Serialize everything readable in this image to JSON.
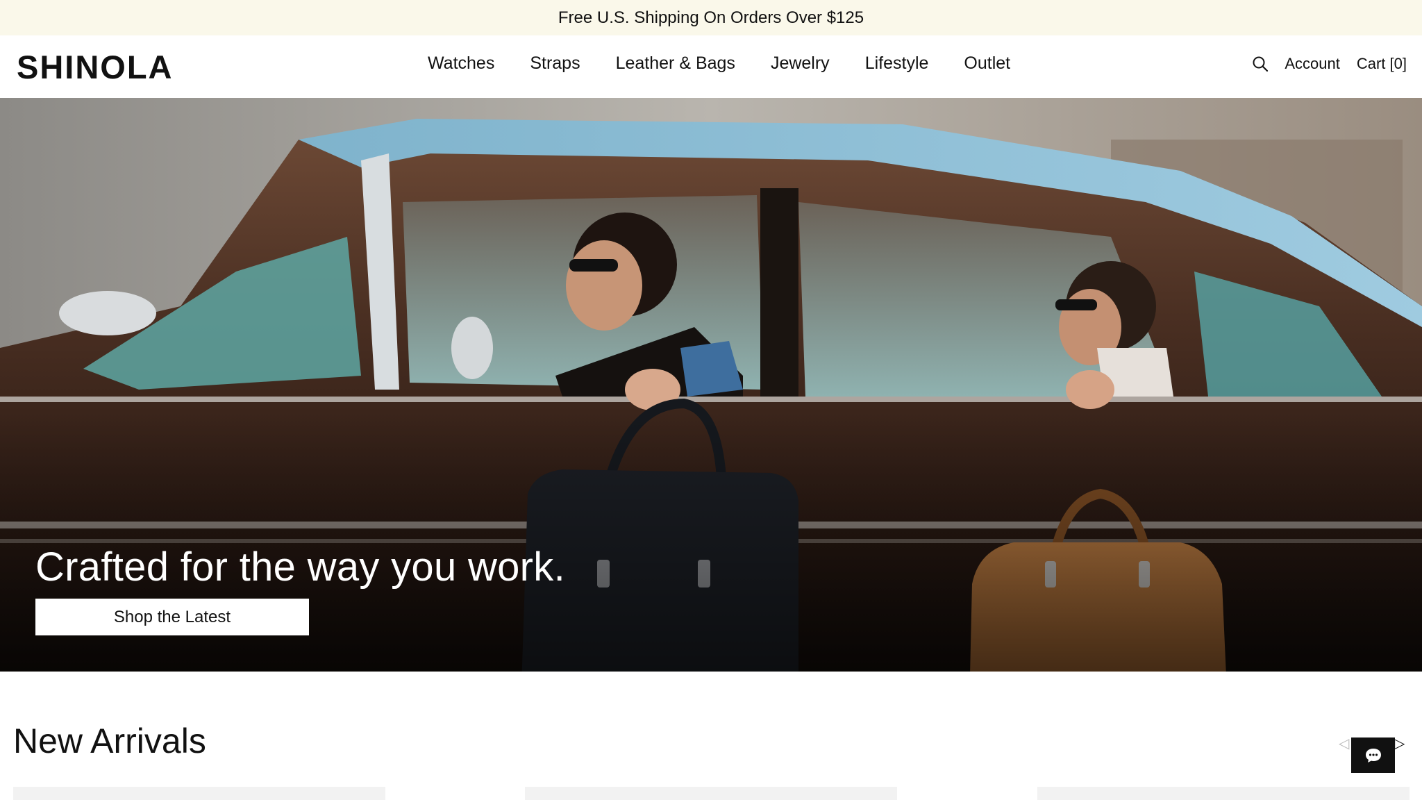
{
  "announcement": {
    "text": "Free U.S. Shipping On Orders Over $125"
  },
  "header": {
    "logo_text": "SHINOLA",
    "nav": [
      {
        "label": "Watches"
      },
      {
        "label": "Straps"
      },
      {
        "label": "Leather & Bags"
      },
      {
        "label": "Jewelry"
      },
      {
        "label": "Lifestyle"
      },
      {
        "label": "Outlet"
      }
    ],
    "search_icon": "search-icon",
    "account_label": "Account",
    "cart_label": "Cart [0]"
  },
  "hero": {
    "title": "Crafted for the way you work.",
    "cta_label": "Shop the Latest"
  },
  "new_arrivals": {
    "title": "New Arrivals",
    "prev_icon": "chevron-left-icon",
    "next_icon": "chevron-right-icon"
  },
  "chat": {
    "icon": "chat-icon"
  },
  "colors": {
    "announcement_bg": "#faf8ea",
    "text": "#111111",
    "cta_bg": "#ffffff",
    "chat_bg": "#111111"
  }
}
